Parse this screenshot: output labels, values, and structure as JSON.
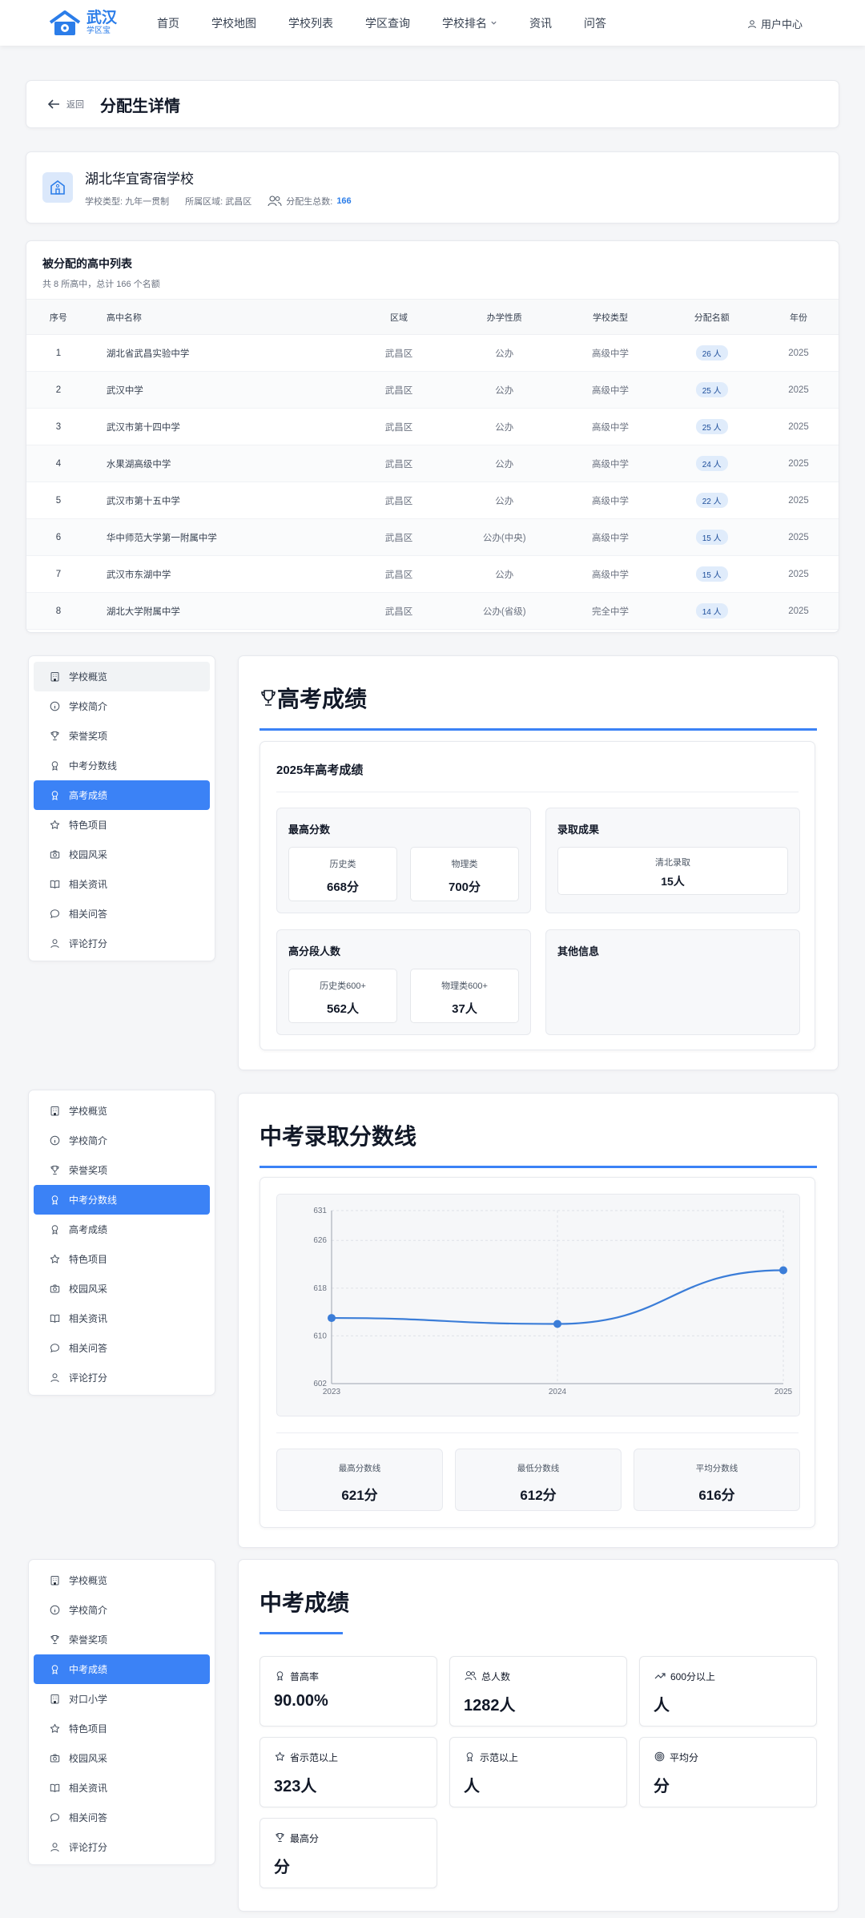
{
  "nav": {
    "logo_title": "武汉",
    "logo_sub": "学区宝",
    "items": [
      "首页",
      "学校地图",
      "学校列表",
      "学区查询",
      "学校排名",
      "资讯",
      "问答"
    ],
    "user_center": "用户中心"
  },
  "header": {
    "back_label": "返回",
    "title": "分配生详情"
  },
  "school": {
    "name": "湖北华宜寄宿学校",
    "type_label": "学校类型: 九年一贯制",
    "area_label": "所属区域: 武昌区",
    "total_label": "分配生总数:",
    "total_value": "166"
  },
  "table": {
    "title": "被分配的高中列表",
    "subtitle": "共 8 所高中，总计 166 个名额",
    "columns": [
      "序号",
      "高中名称",
      "区域",
      "办学性质",
      "学校类型",
      "分配名额",
      "年份"
    ],
    "rows": [
      {
        "idx": "1",
        "name": "湖北省武昌实验中学",
        "area": "武昌区",
        "nature": "公办",
        "type": "高级中学",
        "quota": "26 人",
        "year": "2025"
      },
      {
        "idx": "2",
        "name": "武汉中学",
        "area": "武昌区",
        "nature": "公办",
        "type": "高级中学",
        "quota": "25 人",
        "year": "2025"
      },
      {
        "idx": "3",
        "name": "武汉市第十四中学",
        "area": "武昌区",
        "nature": "公办",
        "type": "高级中学",
        "quota": "25 人",
        "year": "2025"
      },
      {
        "idx": "4",
        "name": "水果湖高级中学",
        "area": "武昌区",
        "nature": "公办",
        "type": "高级中学",
        "quota": "24 人",
        "year": "2025"
      },
      {
        "idx": "5",
        "name": "武汉市第十五中学",
        "area": "武昌区",
        "nature": "公办",
        "type": "高级中学",
        "quota": "22 人",
        "year": "2025"
      },
      {
        "idx": "6",
        "name": "华中师范大学第一附属中学",
        "area": "武昌区",
        "nature": "公办(中央)",
        "type": "高级中学",
        "quota": "15 人",
        "year": "2025"
      },
      {
        "idx": "7",
        "name": "武汉市东湖中学",
        "area": "武昌区",
        "nature": "公办",
        "type": "高级中学",
        "quota": "15 人",
        "year": "2025"
      },
      {
        "idx": "8",
        "name": "湖北大学附属中学",
        "area": "武昌区",
        "nature": "公办(省级)",
        "type": "完全中学",
        "quota": "14 人",
        "year": "2025"
      }
    ]
  },
  "sidebar1": [
    {
      "icon": "building-icon",
      "label": "学校概览"
    },
    {
      "icon": "info-icon",
      "label": "学校简介"
    },
    {
      "icon": "trophy-icon",
      "label": "荣誉奖项"
    },
    {
      "icon": "award-icon",
      "label": "中考分数线"
    },
    {
      "icon": "award-icon",
      "label": "高考成绩"
    },
    {
      "icon": "star-icon",
      "label": "特色项目"
    },
    {
      "icon": "camera-icon",
      "label": "校园风采"
    },
    {
      "icon": "book-icon",
      "label": "相关资讯"
    },
    {
      "icon": "chat-icon",
      "label": "相关问答"
    },
    {
      "icon": "user-icon",
      "label": "评论打分"
    }
  ],
  "sidebar2": [
    {
      "icon": "building-icon",
      "label": "学校概览"
    },
    {
      "icon": "info-icon",
      "label": "学校简介"
    },
    {
      "icon": "trophy-icon",
      "label": "荣誉奖项"
    },
    {
      "icon": "award-icon",
      "label": "中考分数线"
    },
    {
      "icon": "award-icon",
      "label": "高考成绩"
    },
    {
      "icon": "star-icon",
      "label": "特色项目"
    },
    {
      "icon": "camera-icon",
      "label": "校园风采"
    },
    {
      "icon": "book-icon",
      "label": "相关资讯"
    },
    {
      "icon": "chat-icon",
      "label": "相关问答"
    },
    {
      "icon": "user-icon",
      "label": "评论打分"
    }
  ],
  "sidebar3": [
    {
      "icon": "building-icon",
      "label": "学校概览"
    },
    {
      "icon": "info-icon",
      "label": "学校简介"
    },
    {
      "icon": "trophy-icon",
      "label": "荣誉奖项"
    },
    {
      "icon": "award-icon",
      "label": "中考成绩"
    },
    {
      "icon": "building-icon",
      "label": "对口小学"
    },
    {
      "icon": "star-icon",
      "label": "特色项目"
    },
    {
      "icon": "camera-icon",
      "label": "校园风采"
    },
    {
      "icon": "book-icon",
      "label": "相关资讯"
    },
    {
      "icon": "chat-icon",
      "label": "相关问答"
    },
    {
      "icon": "user-icon",
      "label": "评论打分"
    }
  ],
  "gaokao": {
    "title": "高考成绩",
    "year_title": "2025年高考成绩",
    "max_title": "最高分数",
    "history_label": "历史类",
    "history_value": "668分",
    "physics_label": "物理类",
    "physics_value": "700分",
    "admission_title": "录取成果",
    "qingbei_label": "清北录取",
    "qingbei_value": "15人",
    "high_title": "高分段人数",
    "hist600_label": "历史类600+",
    "hist600_value": "562人",
    "phys600_label": "物理类600+",
    "phys600_value": "37人",
    "other_title": "其他信息"
  },
  "zhongkao_line": {
    "title": "中考录取分数线",
    "max_label": "最高分数线",
    "max_value": "621分",
    "min_label": "最低分数线",
    "min_value": "612分",
    "avg_label": "平均分数线",
    "avg_value": "616分"
  },
  "chart_data": {
    "type": "line",
    "x": [
      "2023",
      "2024",
      "2025"
    ],
    "series": [
      {
        "values": [
          613,
          612,
          621
        ]
      }
    ],
    "y_ticks": [
      "631",
      "626",
      "618",
      "610",
      "602"
    ],
    "ylim": [
      602,
      631
    ],
    "grid": true,
    "color": "#3b7dd8"
  },
  "zhongkao": {
    "title": "中考成绩",
    "stats": [
      {
        "icon": "award-icon",
        "label": "普高率",
        "value": "90.00%"
      },
      {
        "icon": "users-icon",
        "label": "总人数",
        "value": "1282人"
      },
      {
        "icon": "trend-icon",
        "label": "600分以上",
        "value": "人"
      },
      {
        "icon": "star-icon",
        "label": "省示范以上",
        "value": "323人"
      },
      {
        "icon": "award-icon",
        "label": "示范以上",
        "value": "人"
      },
      {
        "icon": "target-icon",
        "label": "平均分",
        "value": "分"
      },
      {
        "icon": "trophy-icon",
        "label": "最高分",
        "value": "分"
      }
    ]
  }
}
